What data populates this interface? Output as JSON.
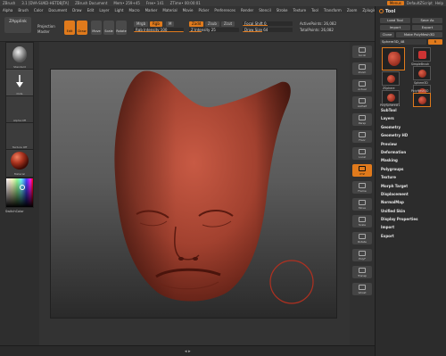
{
  "titlebar": {
    "app": "ZBrush",
    "version": "3.1 [DVA-SUKD-HETDBJTA]",
    "document": "ZBrush Document",
    "mem": "Mem• 259+45",
    "free": "Free• 141",
    "ztime": "ZTime• 00:00:01",
    "menus_btn": "Menus",
    "default_script": "DefaultZScript",
    "help": "Help"
  },
  "menubar": {
    "items": [
      "Alpha",
      "Brush",
      "Color",
      "Document",
      "Draw",
      "Edit",
      "Layer",
      "Light",
      "Macro",
      "Marker",
      "Material",
      "Movie",
      "Picker",
      "Preferences",
      "Render",
      "Stencil",
      "Stroke",
      "Texture",
      "Tool",
      "Transform",
      "Zoom",
      "Zplugin",
      "Zscript"
    ]
  },
  "toolbar": {
    "zapplink": "ZApplink",
    "projection": "Projection",
    "master": "Master",
    "btn_edit": "Edit",
    "btn_draw": "Draw",
    "btn_move": "Move",
    "btn_scale": "Scale",
    "btn_rotate": "Rotate",
    "mrgb": "Mrgb",
    "rgb": "Rgb",
    "m": "M",
    "zadd": "Zadd",
    "zsub": "Zsub",
    "zcut": "Zcut",
    "rgb_intensity": "Rgb Intensity 100",
    "z_intensity": "Z Intensity 25",
    "focal_shift": "Focal Shift 0",
    "draw_size": "Draw Size 64",
    "active_points": "ActivePoints: 26,082",
    "total_points": "TotalPoints: 26,082"
  },
  "lefttray": {
    "brush_label": "Standard",
    "stroke_label": "Dots",
    "alpha_label": "Alpha Off",
    "texture_label": "Texture Off",
    "material_label": "Material",
    "switchcolor": "SwitchColor"
  },
  "righttray": {
    "buttons": [
      "Scroll",
      "Zoom",
      "Actual",
      "AAHalf",
      "Persp",
      "Floor",
      "Local",
      "XYZ",
      "Frame",
      "Move",
      "Scale",
      "Rotate",
      "PolyF",
      "Transp",
      "Ghost"
    ]
  },
  "toolpanel": {
    "title": "Tool",
    "load_tool": "Load Tool",
    "save_as": "Save As",
    "import": "Import",
    "export": "Export",
    "clone": "Clone",
    "make_polymesh": "Make PolyMesh3D",
    "current_tool": "Sphere3D_48",
    "tools": [
      "SimpleBrush",
      "Sphere3D",
      "ZSphere",
      "PolyMesh3D",
      "PolySphere#1",
      "Sphere3D_48"
    ],
    "sections": [
      "SubTool",
      "Layers",
      "Geometry",
      "Geometry HD",
      "Preview",
      "Deformation",
      "Masking",
      "Polygroups",
      "Texture",
      "Morph Target",
      "Displacement",
      "NormalMap",
      "Unified Skin",
      "Display Properties",
      "Import",
      "Export"
    ]
  }
}
